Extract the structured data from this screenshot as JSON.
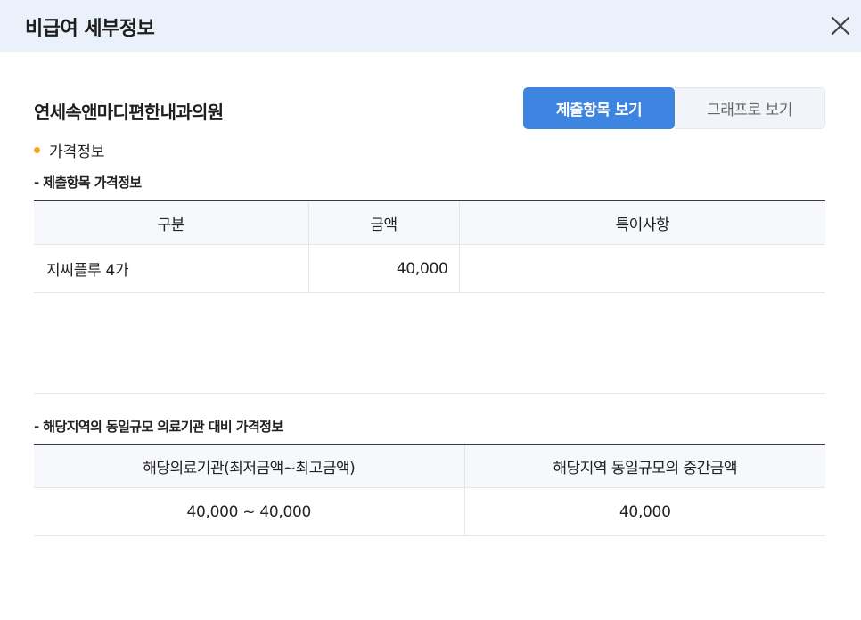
{
  "modal": {
    "title": "비급여 세부정보",
    "close_label": "✕"
  },
  "hospital": {
    "name": "연세속앤마디편한내과의원"
  },
  "view_toggle": {
    "submitted_items_label": "제출항목 보기",
    "graph_label": "그래프로 보기",
    "active": "submitted_items"
  },
  "price_info": {
    "heading": "가격정보",
    "submitted": {
      "heading": "- 제출항목 가격정보",
      "columns": [
        "구분",
        "금액",
        "특이사항"
      ],
      "rows": [
        {
          "item": "지씨플루 4가",
          "amount": "40,000",
          "note": ""
        }
      ]
    },
    "regional": {
      "heading": "- 해당지역의 동일규모 의료기관 대비 가격정보",
      "columns": [
        "해당의료기관(최저금액~최고금액)",
        "해당지역 동일규모의 중간금액"
      ],
      "rows": [
        {
          "range": "40,000 ~ 40,000",
          "median": "40,000"
        }
      ]
    }
  },
  "colors": {
    "header_bg": "#eaf1fb",
    "accent": "#3d85e0",
    "bullet": "#f5a623"
  }
}
